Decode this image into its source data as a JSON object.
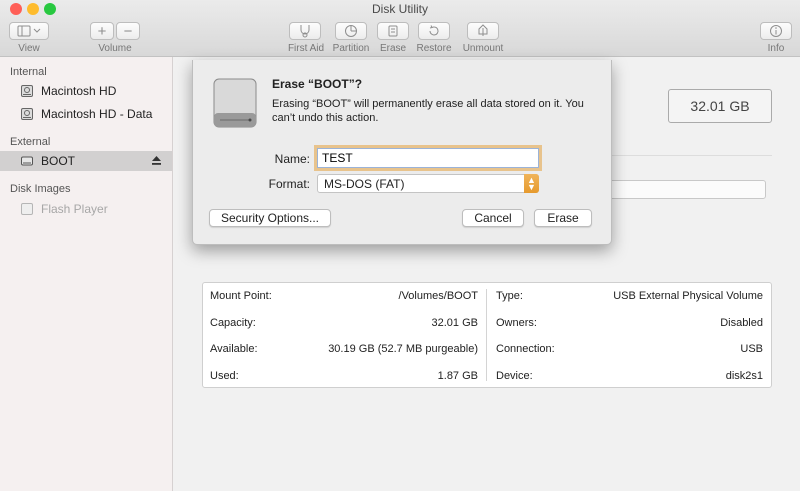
{
  "window": {
    "title": "Disk Utility"
  },
  "toolbar": {
    "view_label": "View",
    "volume_label": "Volume",
    "first_aid_label": "First Aid",
    "partition_label": "Partition",
    "erase_label": "Erase",
    "restore_label": "Restore",
    "unmount_label": "Unmount",
    "info_label": "Info",
    "volume_add": "+",
    "volume_remove": "−"
  },
  "sidebar": {
    "internal_header": "Internal",
    "external_header": "External",
    "images_header": "Disk Images",
    "items": [
      {
        "label": "Macintosh HD",
        "icon": "internal-disk-icon"
      },
      {
        "label": "Macintosh HD - Data",
        "icon": "internal-disk-icon"
      },
      {
        "label": "BOOT",
        "icon": "external-disk-icon",
        "selected": true
      },
      {
        "label": "Flash Player",
        "icon": "disk-image-icon",
        "disabled": true
      }
    ]
  },
  "main": {
    "capacity_display": "32.01 GB"
  },
  "info": {
    "left": [
      {
        "label": "Mount Point:",
        "value": "/Volumes/BOOT"
      },
      {
        "label": "Capacity:",
        "value": "32.01 GB"
      },
      {
        "label": "Available:",
        "value": "30.19 GB (52.7 MB purgeable)"
      },
      {
        "label": "Used:",
        "value": "1.87 GB"
      }
    ],
    "right": [
      {
        "label": "Type:",
        "value": "USB External Physical Volume"
      },
      {
        "label": "Owners:",
        "value": "Disabled"
      },
      {
        "label": "Connection:",
        "value": "USB"
      },
      {
        "label": "Device:",
        "value": "disk2s1"
      }
    ]
  },
  "dialog": {
    "title": "Erase “BOOT”?",
    "message": "Erasing “BOOT” will permanently erase all data stored on it. You can’t undo this action.",
    "name_label": "Name:",
    "name_value": "TEST",
    "format_label": "Format:",
    "format_value": "MS-DOS (FAT)",
    "security_button": "Security Options...",
    "cancel_button": "Cancel",
    "erase_button": "Erase"
  },
  "colors": {
    "accent": "#e69a2d",
    "focus_ring": "#e8c38c",
    "close": "#ff5f57",
    "minimize": "#febc2e",
    "zoom": "#28c840"
  }
}
